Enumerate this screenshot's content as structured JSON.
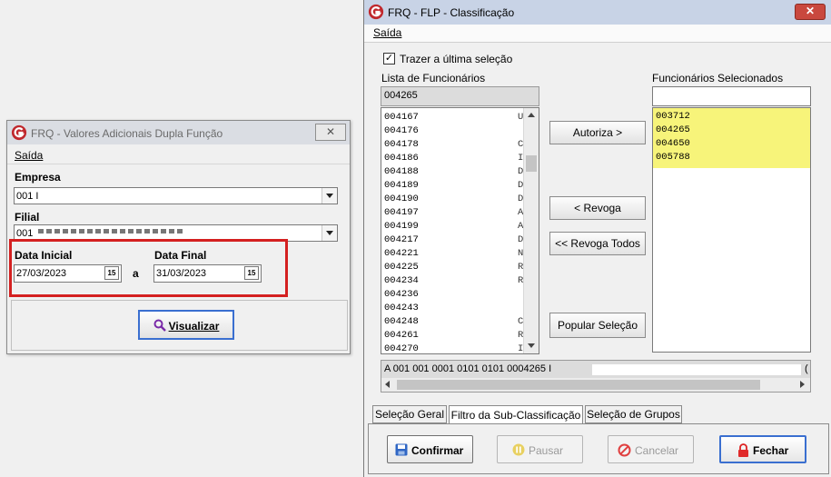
{
  "window1": {
    "title": "FRQ - Valores Adicionais Dupla Função",
    "close_label": "✕",
    "menu": "Saída",
    "empresa_label": "Empresa",
    "empresa_value": "001 I",
    "filial_label": "Filial",
    "filial_value": "001",
    "data_inicial_label": "Data Inicial",
    "data_inicial_value": "27/03/2023",
    "data_final_label": "Data Final",
    "data_final_value": "31/03/2023",
    "date_sep": "a",
    "calendar_icon_text": "15",
    "visualizar_label": "Visualizar"
  },
  "window2": {
    "title": "FRQ - FLP - Classificação",
    "close_label": "✕",
    "menu": "Saída",
    "checkbox_label": "Trazer a última seleção",
    "checkbox_checked": true,
    "lista_label": "Lista de Funcionários",
    "search_value": "004265",
    "selecionados_label": "Funcionários Selecionados",
    "funcionarios": [
      {
        "code": "004167",
        "d": "U"
      },
      {
        "code": "004176",
        "d": ""
      },
      {
        "code": "004178",
        "d": "C"
      },
      {
        "code": "004186",
        "d": "I"
      },
      {
        "code": "004188",
        "d": "D"
      },
      {
        "code": "004189",
        "d": "D"
      },
      {
        "code": "004190",
        "d": "D"
      },
      {
        "code": "004197",
        "d": "A"
      },
      {
        "code": "004199",
        "d": "A"
      },
      {
        "code": "004217",
        "d": "D"
      },
      {
        "code": "004221",
        "d": "N"
      },
      {
        "code": "004225",
        "d": "R"
      },
      {
        "code": "004234",
        "d": "R"
      },
      {
        "code": "004236",
        "d": ""
      },
      {
        "code": "004243",
        "d": ""
      },
      {
        "code": "004248",
        "d": "C"
      },
      {
        "code": "004261",
        "d": "R"
      },
      {
        "code": "004270",
        "d": "I"
      }
    ],
    "selecionados": [
      "003712",
      "004265",
      "004650",
      "005788"
    ],
    "btn_autoriza": "Autoriza >",
    "btn_revoga": "< Revoga",
    "btn_revoga_todos": "<< Revoga Todos",
    "btn_popular": "Popular Seleção",
    "code_line": "A 001 001 0001 0101 0101 0004265 I",
    "code_line_right": "(",
    "tabs": [
      "Seleção Geral",
      "Filtro da Sub-Classificação",
      "Seleção de Grupos"
    ],
    "active_tab": 1,
    "btn_confirmar": "Confirmar",
    "btn_pausar": "Pausar",
    "btn_cancelar": "Cancelar",
    "btn_fechar": "Fechar"
  },
  "colors": {
    "highlight_selected": "#f7f47a",
    "red_annotation": "#d42020",
    "title_active": "#c8d3e6"
  }
}
